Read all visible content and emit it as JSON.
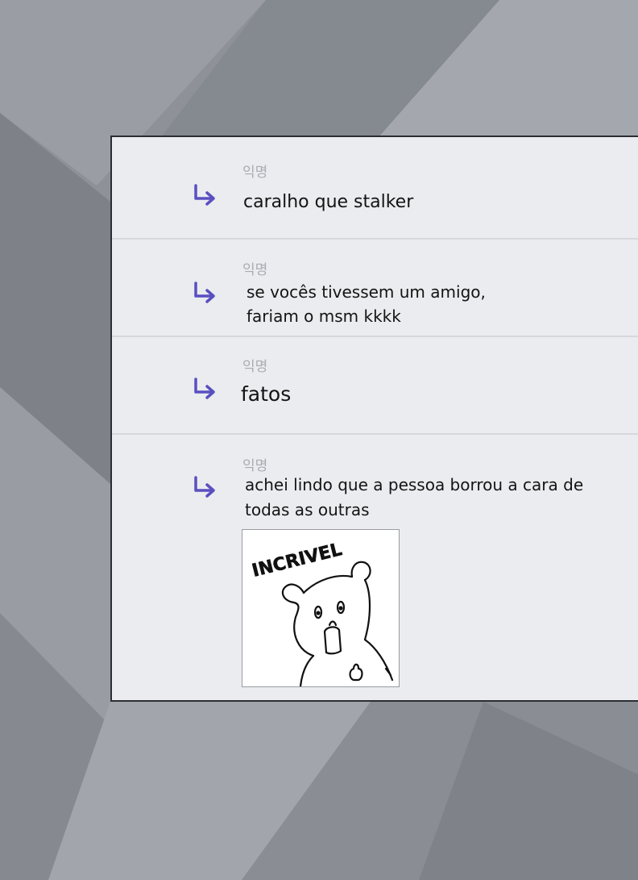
{
  "comments": [
    {
      "author": "익명",
      "text": "caralho que stalker",
      "icon": "reply-arrow-icon"
    },
    {
      "author": "익명",
      "text_lines": [
        "se vocês tivessem um amigo,",
        "fariam o msm kkkk"
      ],
      "icon": "reply-arrow-icon"
    },
    {
      "author": "익명",
      "text": "fatos",
      "icon": "reply-arrow-icon"
    },
    {
      "author": "익명",
      "text_lines": [
        "achei lindo que a pessoa borrou a cara de",
        "todas as outras"
      ],
      "icon": "reply-arrow-icon",
      "sticker": {
        "caption": "INCRIVEL",
        "icon": "bear-sticker-icon"
      }
    }
  ],
  "colors": {
    "accent": "#5a4fc0",
    "panel_bg": "#eaecef",
    "author": "#a9acb1",
    "text": "#141414"
  }
}
